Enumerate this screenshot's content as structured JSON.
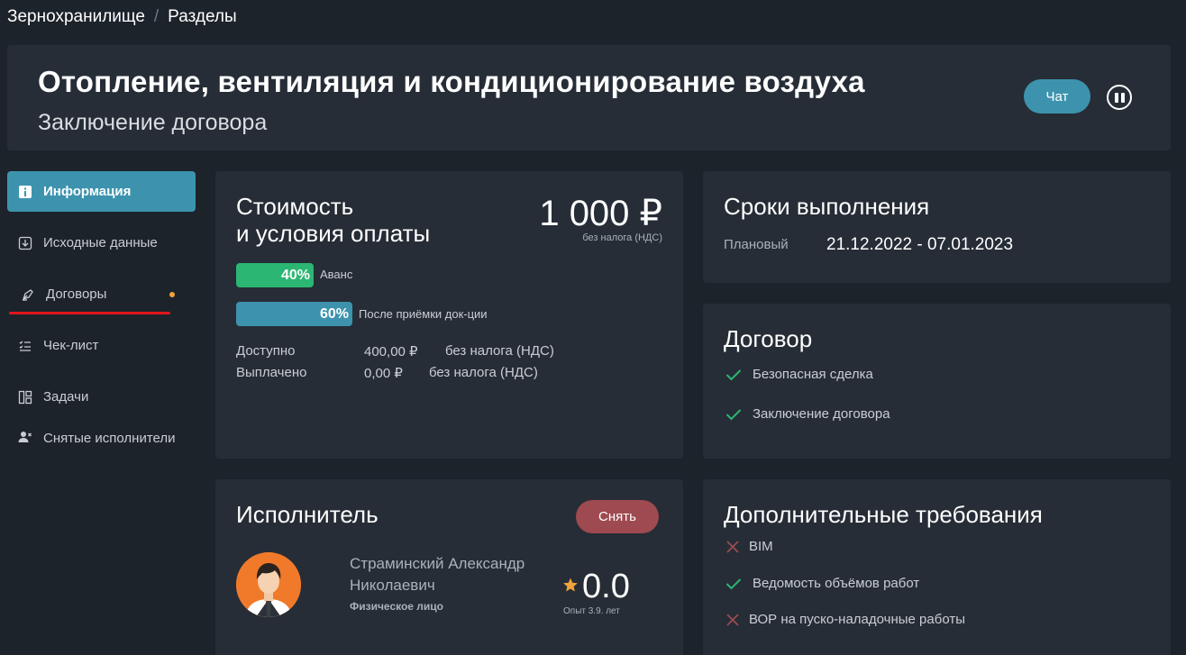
{
  "breadcrumb": {
    "root": "Зернохранилище",
    "separator": "/",
    "current": "Разделы"
  },
  "header": {
    "title": "Отопление, вентиляция и кондиционирование воздуха",
    "subtitle": "Заключение договора",
    "chat_label": "Чат"
  },
  "sidebar": {
    "items": [
      {
        "label": "Информация",
        "icon": "info-icon",
        "active": true
      },
      {
        "label": "Исходные данные",
        "icon": "download-icon"
      },
      {
        "label": "Договоры",
        "icon": "pen-icon",
        "has_dot": true
      },
      {
        "label": "Чек-лист",
        "icon": "checklist-icon"
      },
      {
        "label": "Задачи",
        "icon": "board-icon"
      },
      {
        "label": "Снятые исполнители",
        "icon": "user-removed-icon"
      }
    ]
  },
  "cost": {
    "title_line1": "Стоимость",
    "title_line2": "и условия оплаты",
    "price": "1 000 ₽",
    "price_note": "без налога (НДС)",
    "advance": {
      "percent_label": "40%",
      "percent": 40,
      "label": "Аванс"
    },
    "after": {
      "percent_label": "60%",
      "percent": 60,
      "label": "После приёмки док-ции"
    },
    "available_label": "Доступно",
    "available_value": "400,00 ₽",
    "available_note": "без налога (НДС)",
    "paid_label": "Выплачено",
    "paid_value": "0,00 ₽",
    "paid_note": "без налога (НДС)"
  },
  "terms": {
    "title": "Сроки выполнения",
    "planned_label": "Плановый",
    "planned_value": "21.12.2022 - 07.01.2023"
  },
  "contract": {
    "title": "Договор",
    "items": [
      {
        "label": "Безопасная сделка",
        "ok": true
      },
      {
        "label": "Заключение договора",
        "ok": true
      }
    ]
  },
  "executor": {
    "title": "Исполнитель",
    "remove_label": "Снять",
    "name": "Страминский Александр Николаевич",
    "type": "Физическое лицо",
    "rating": "0.0",
    "experience": "Опыт 3.9. лет"
  },
  "extra": {
    "title": "Дополнительные требования",
    "items": [
      {
        "label": "BIM",
        "ok": false
      },
      {
        "label": "Ведомость объёмов работ",
        "ok": true
      },
      {
        "label": "ВОР на пуско-наладочные работы",
        "ok": false
      }
    ]
  },
  "colors": {
    "accent": "#3d93ae",
    "success": "#2bb673",
    "danger": "#9e4a50",
    "warning_dot": "#f0a33a",
    "card_bg": "#262d36",
    "page_bg": "#1d232b"
  }
}
